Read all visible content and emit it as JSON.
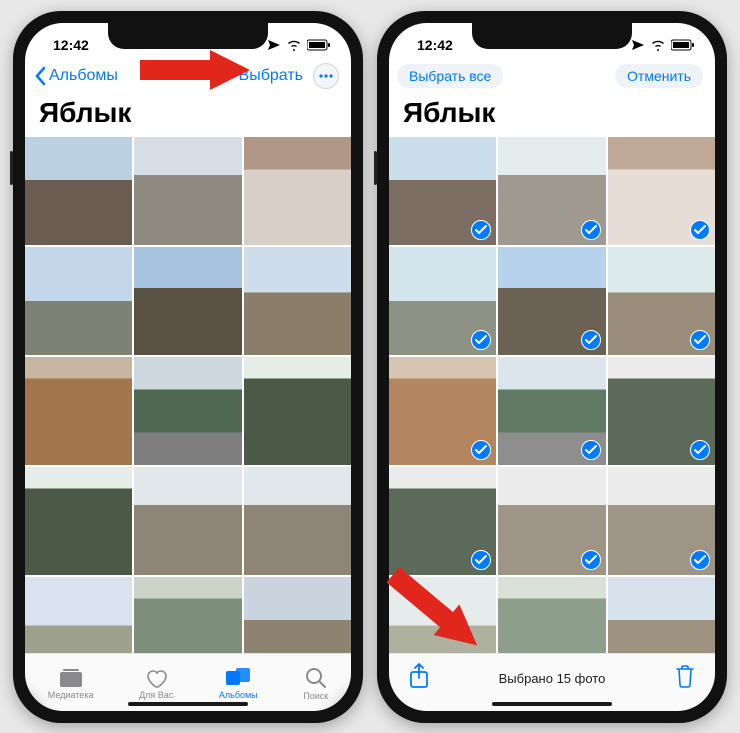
{
  "status": {
    "time": "12:42"
  },
  "phone1": {
    "nav": {
      "back": "Альбомы",
      "select": "Выбрать"
    },
    "title": "Яблык",
    "tabs": {
      "library": "Медиатека",
      "foryou": "Для Вас",
      "albums": "Альбомы",
      "search": "Поиск"
    }
  },
  "phone2": {
    "nav": {
      "select_all": "Выбрать все",
      "cancel": "Отменить"
    },
    "title": "Яблык",
    "toolbar": {
      "status": "Выбрано 15 фото"
    }
  },
  "photos": [
    {
      "cls": "church"
    },
    {
      "cls": "cobble"
    },
    {
      "cls": "girl"
    },
    {
      "cls": "tower"
    },
    {
      "cls": "dome"
    },
    {
      "cls": "opera"
    },
    {
      "cls": "brick"
    },
    {
      "cls": "road"
    },
    {
      "cls": "gorge"
    },
    {
      "cls": "gorge"
    },
    {
      "cls": "spire"
    },
    {
      "cls": "spire"
    },
    {
      "cls": "arch"
    },
    {
      "cls": "falls"
    },
    {
      "cls": "ruins"
    }
  ],
  "selected_count": 15
}
